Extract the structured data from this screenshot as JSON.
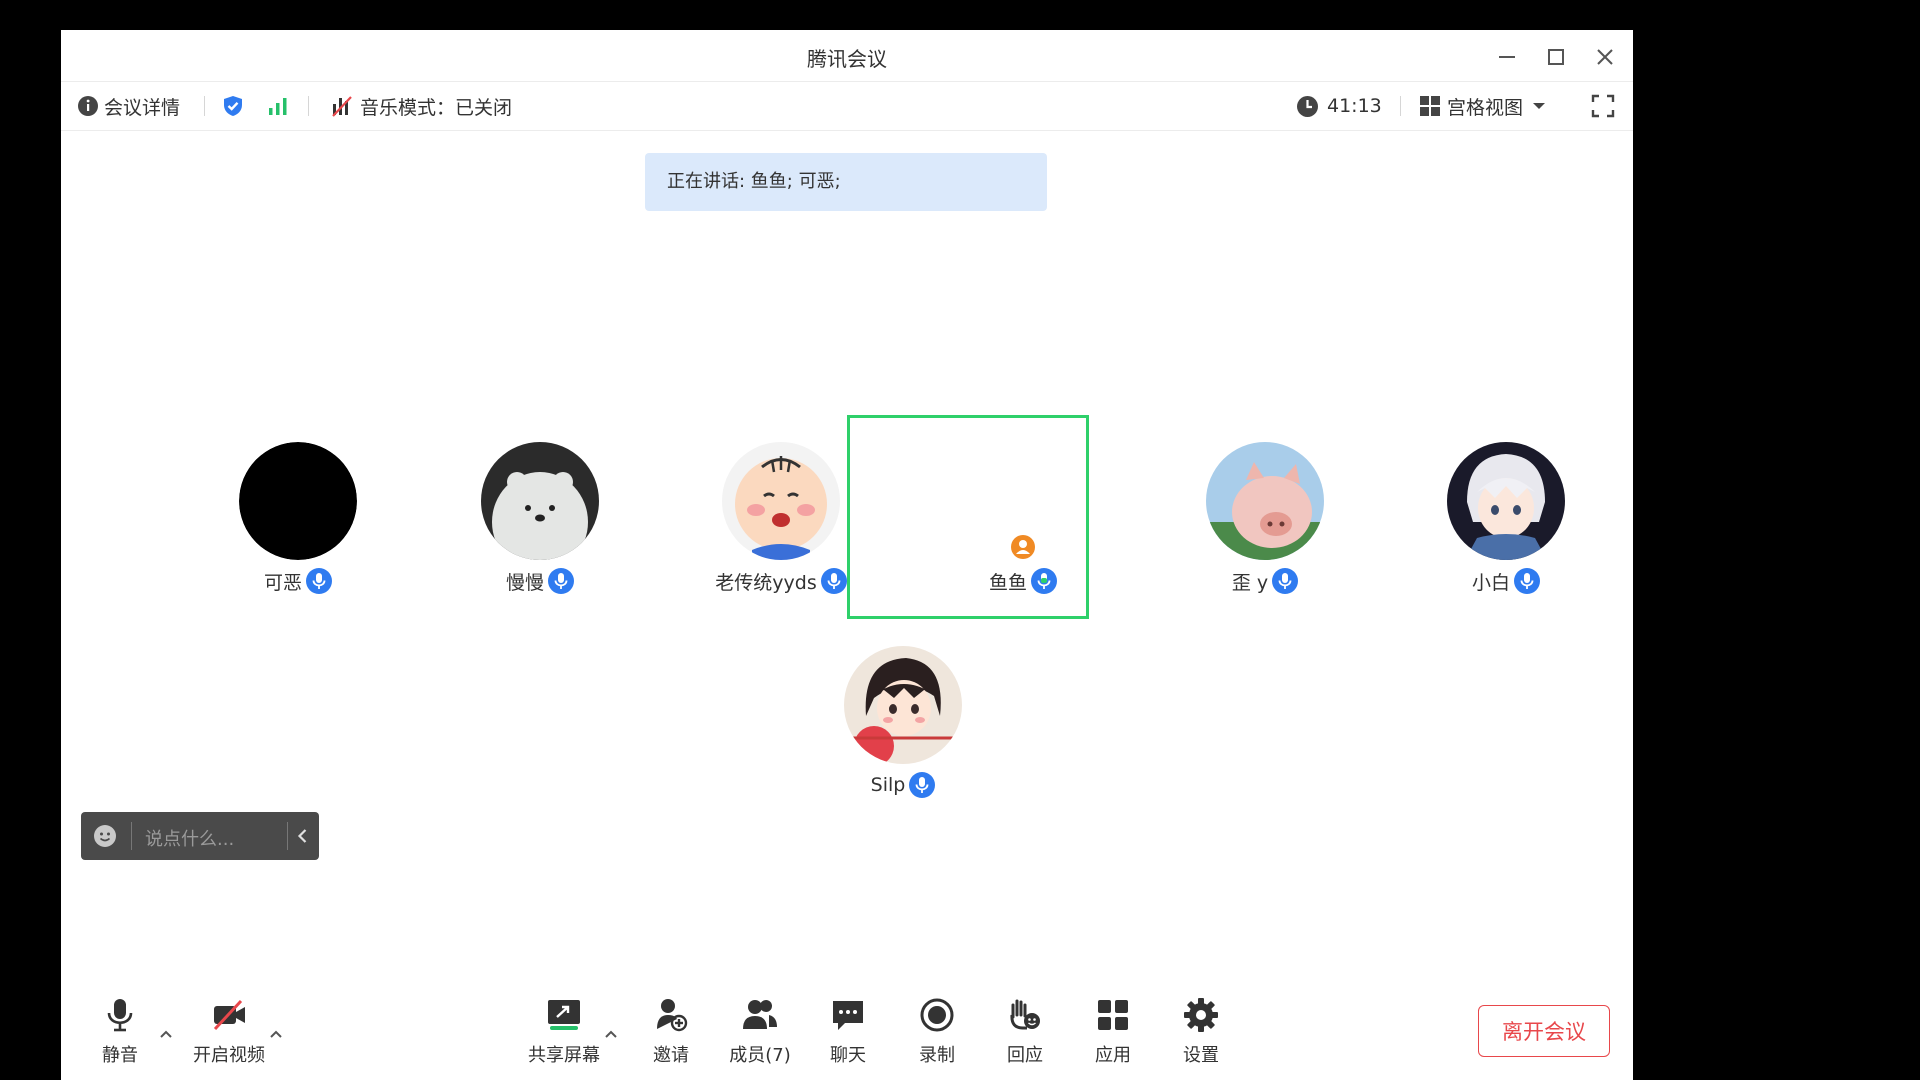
{
  "window": {
    "title": "腾讯会议"
  },
  "infobar": {
    "meeting_details": "会议详情",
    "music_mode": "音乐模式：已关闭",
    "timer": "41:13",
    "view_mode": "宫格视图"
  },
  "speaking": "正在讲话: 鱼鱼; 可恶;",
  "participants": [
    {
      "name": "可恶",
      "avatar": "black-circle"
    },
    {
      "name": "慢慢",
      "avatar": "ice-bear"
    },
    {
      "name": "老传统yyds",
      "avatar": "cartoon-boy"
    },
    {
      "name": "鱼鱼",
      "avatar": "default-user",
      "active": true
    },
    {
      "name": "歪 y",
      "avatar": "pig-photo"
    },
    {
      "name": "小白",
      "avatar": "anime-white-hair"
    },
    {
      "name": "Silp",
      "avatar": "anime-girl-boxing"
    }
  ],
  "chat": {
    "placeholder": "说点什么..."
  },
  "toolbar": {
    "mute": "静音",
    "video": "开启视频",
    "share": "共享屏幕",
    "invite": "邀请",
    "members": "成员(7)",
    "chat": "聊天",
    "record": "录制",
    "react": "回应",
    "apps": "应用",
    "settings": "设置",
    "leave": "离开会议"
  },
  "colors": {
    "accent_blue": "#2f7bf0",
    "active_green": "#2ed06a",
    "leave_red": "#e8474b",
    "speaking_bg": "#dbe9fb"
  }
}
